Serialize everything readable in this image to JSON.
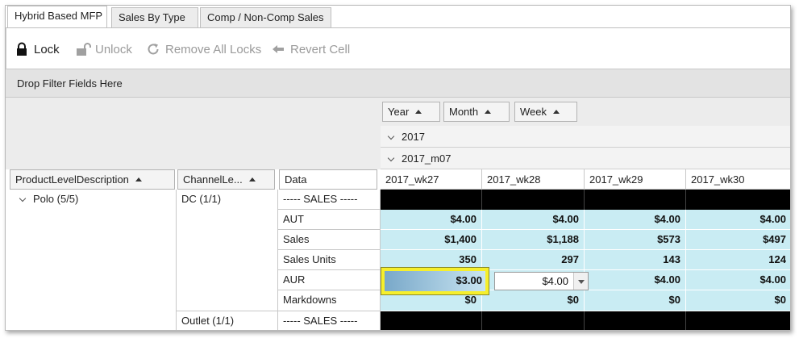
{
  "tabs": [
    {
      "label": "Hybrid Based MFP",
      "active": true
    },
    {
      "label": "Sales By Type",
      "active": false
    },
    {
      "label": "Comp / Non-Comp Sales",
      "active": false
    }
  ],
  "toolbar": {
    "lock": "Lock",
    "unlock": "Unlock",
    "remove_all_locks": "Remove All Locks",
    "revert_cell": "Revert Cell"
  },
  "filter_area": "Drop Filter Fields Here",
  "column_fields": {
    "year": "Year",
    "month": "Month",
    "week": "Week"
  },
  "row_fields": {
    "product": "ProductLevelDescription",
    "channel": "ChannelLe...",
    "data": "Data"
  },
  "year_value": "2017",
  "month_value": "2017_m07",
  "weeks": [
    "2017_wk27",
    "2017_wk28",
    "2017_wk29",
    "2017_wk30"
  ],
  "product_group": "Polo (5/5)",
  "channels": [
    "DC (1/1)",
    "Outlet (1/1)"
  ],
  "measures": [
    "----- SALES -----",
    "AUT",
    "Sales",
    "Sales Units",
    "AUR",
    "Markdowns",
    "----- SALES -----"
  ],
  "values": {
    "aut": [
      "$4.00",
      "$4.00",
      "$4.00",
      "$4.00"
    ],
    "sales": [
      "$1,400",
      "$1,188",
      "$573",
      "$497"
    ],
    "sales_units": [
      "350",
      "297",
      "143",
      "124"
    ],
    "aur": [
      "$3.00",
      "$4.00",
      "$4.00",
      "$4.00"
    ],
    "markdowns": [
      "$0",
      "$0",
      "$0",
      "$0"
    ]
  },
  "colors": {
    "data_cell": "#c9ecf3",
    "highlight": "#f6ef2c",
    "filter_bar": "#e3e3e3"
  }
}
